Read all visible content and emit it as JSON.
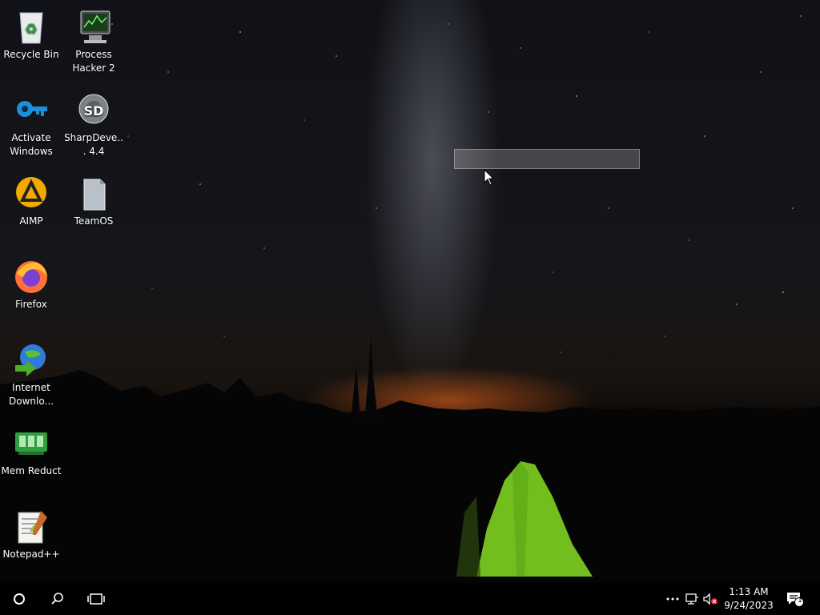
{
  "desktop": {
    "icons": [
      {
        "label": "Recycle Bin",
        "icon": "recycle-bin-icon"
      },
      {
        "label": "Process Hacker 2",
        "icon": "process-hacker-icon"
      },
      {
        "label": "Activate Windows",
        "icon": "key-icon"
      },
      {
        "label": "SharpDeve... 4.4",
        "icon": "sharpdevelop-icon"
      },
      {
        "label": "AIMP",
        "icon": "aimp-icon"
      },
      {
        "label": "TeamOS",
        "icon": "teamos-icon"
      },
      {
        "label": "Firefox",
        "icon": "firefox-icon"
      },
      {
        "label": "Internet Downlo...",
        "icon": "internet-download-manager-icon"
      },
      {
        "label": "Mem Reduct",
        "icon": "mem-reduct-icon"
      },
      {
        "label": "Notepad++",
        "icon": "notepad-plus-plus-icon"
      }
    ]
  },
  "taskbar": {
    "start_icon": "start-icon",
    "search_icon": "search-icon",
    "task_view_icon": "task-view-icon",
    "tray": {
      "overflow_icon": "show-hidden-icons-icon",
      "network_icon": "network-icon",
      "volume_icon": "volume-muted-icon",
      "time": "1:13 AM",
      "date": "9/24/2023",
      "notification_count": "1"
    }
  },
  "colors": {
    "taskbar_bg": "#000000",
    "tent_green": "#7ed321",
    "horizon_glow": "#ff6a1e"
  }
}
